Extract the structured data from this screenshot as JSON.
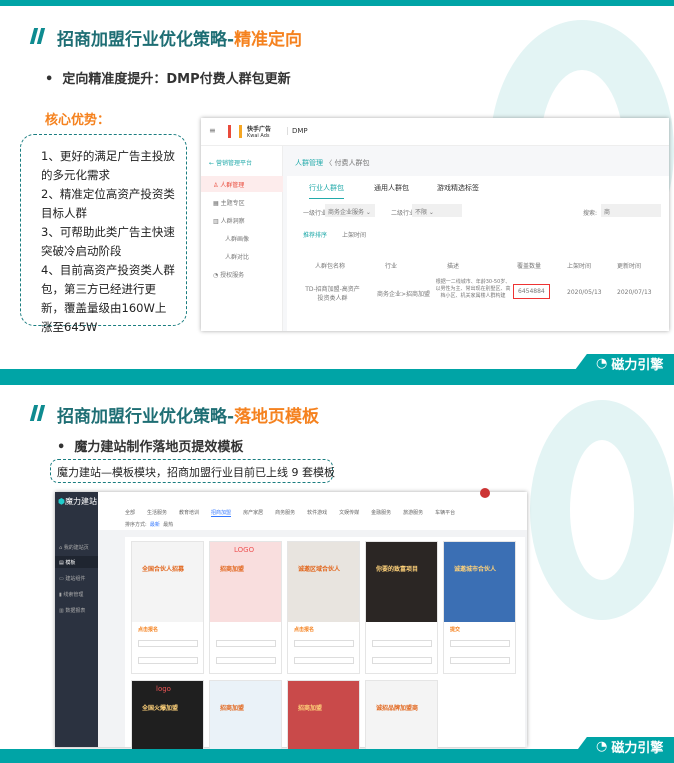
{
  "slide1": {
    "title_main": "招商加盟行业优化策略-",
    "title_highlight": "精准定向",
    "bullet": "定向精准度提升：DMP付费人群包更新",
    "advantages_heading": "核心优势：",
    "advantages": [
      "1、更好的满足广告主投放的多元化需求",
      "2、精准定位高资产投资类目标人群",
      "3、可帮助此类广告主快速突破冷启动阶段",
      "4、目前高资产投资类人群包，第三方已经进行更新，覆盖量级由160W上涨至645W"
    ],
    "dmp": {
      "logo_cn": "快手广告",
      "logo_en": "Kwai Ads",
      "product": "DMP",
      "back": "营销管理平台",
      "nav": [
        "人群管理",
        "主题专区",
        "人群洞察",
        "人群画像",
        "人群对比",
        "授权服务"
      ],
      "breadcrumb": [
        "人群管理",
        "付费人群包"
      ],
      "tabs": [
        "行业人群包",
        "通用人群包",
        "游戏精选标签"
      ],
      "filter1_label": "一级行业",
      "filter1_value": "商务企业服务",
      "filter2_label": "二级行业",
      "filter2_value": "不限",
      "search_label": "搜索:",
      "search_value": "商",
      "sort": [
        "推荐排序",
        "上架时间"
      ],
      "columns": [
        "人群包名称",
        "行业",
        "描述",
        "覆盖数量",
        "上架时间",
        "更新时间"
      ],
      "row": [
        "TD-招商加盟-高资产投资类人群",
        "商务企业>招商加盟",
        "根据一二线城市、年龄30-50岁、以男性为主、常出现在别墅区、高档小区、机关家属楼人群构建",
        "6454884",
        "2020/05/13",
        "2020/07/13"
      ]
    },
    "footer_brand": "磁力引擎"
  },
  "slide2": {
    "title_main": "招商加盟行业优化策略-",
    "title_highlight": "落地页模板",
    "bullet": "魔力建站制作落地页提效模板",
    "note": "魔力建站—模板模块，招商加盟行业目前已上线 9 套模板",
    "site": {
      "logo": "魔力建站",
      "nav": [
        "我的建站页",
        "模板",
        "建站组件",
        "线索管理",
        "数据报表"
      ],
      "categories": [
        "全部",
        "生活服务",
        "教育培训",
        "招商加盟",
        "房产家居",
        "商务服务",
        "软件游戏",
        "文娱传媒",
        "金融服务",
        "旅游服务",
        "车辆平台"
      ],
      "sort_label": "排序方式:",
      "sort_options": [
        "最新",
        "最热"
      ],
      "templates": [
        {
          "title": "全国合伙人招募",
          "button": "点击报名",
          "bg": "#f4f4f4"
        },
        {
          "title": "招商加盟",
          "logo": "LOGO",
          "bg": "#f9dede"
        },
        {
          "title": "诚邀区域合伙人",
          "button": "点击报名",
          "bg": "#e8e4df"
        },
        {
          "title": "你要的致富项目",
          "bg": "#2b2624"
        },
        {
          "title": "诚邀城市合伙人",
          "button": "提交",
          "bg": "#3b6fb4"
        },
        {
          "title": "全国火爆加盟",
          "logo": "logo",
          "bg": "#1f1f1f"
        },
        {
          "title": "招商加盟",
          "bg": "#eaf2f8"
        },
        {
          "title": "招商加盟",
          "bg": "#c94a4a"
        },
        {
          "title": "诚招品牌加盟商",
          "bg": "#f4f4f4"
        }
      ]
    },
    "footer_brand": "磁力引擎"
  },
  "colors": {
    "teal": "#00a4a6",
    "orange": "#f5821f",
    "title": "#1e6e74"
  }
}
